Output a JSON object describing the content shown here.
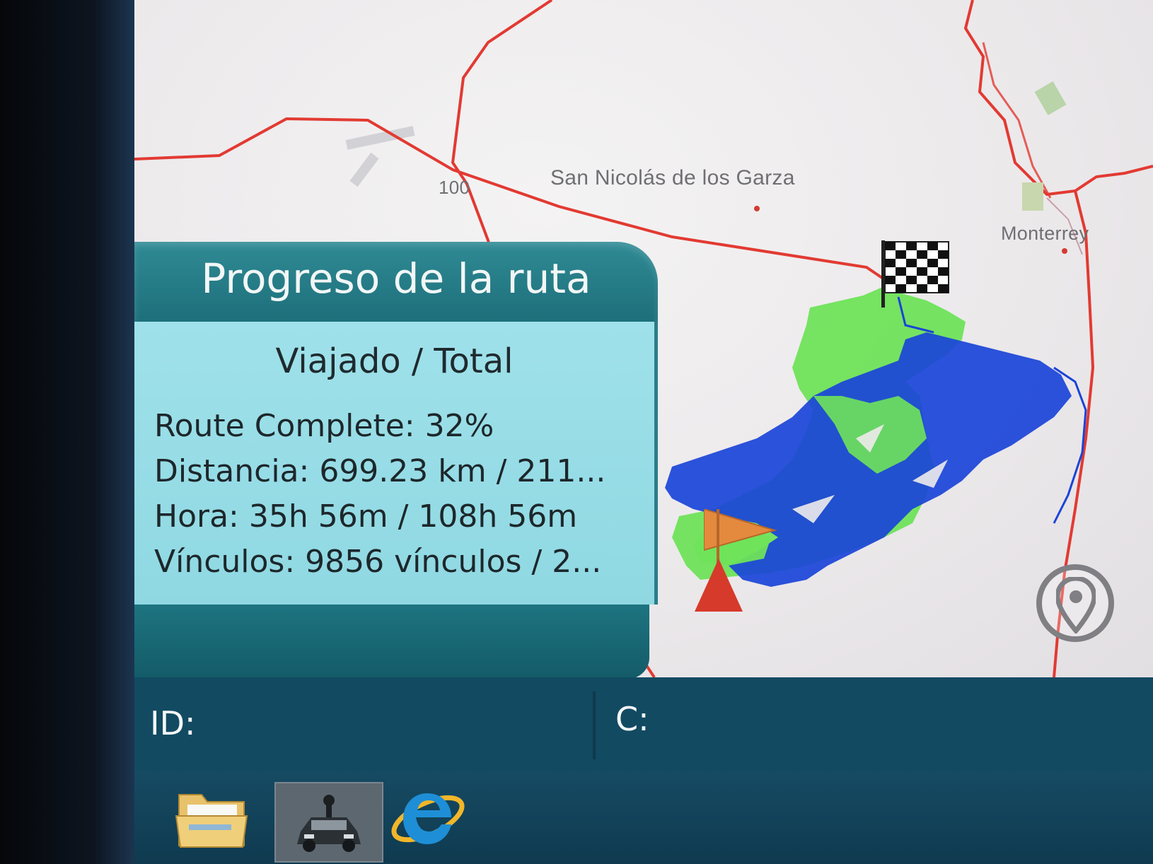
{
  "map": {
    "labels": {
      "road_number": "100",
      "city_1": "San Nicolás de los Garza",
      "city_2": "Monterrey"
    },
    "colors": {
      "road": "#e23a32",
      "route_traveled": "#1a44d8",
      "coverage": "#6fe35a",
      "background": "#eeebec"
    },
    "icons": {
      "destination": "checkered-flag-icon",
      "start": "start-flag-icon",
      "vehicle": "vehicle-cone-icon",
      "locate": "location-pin-icon"
    }
  },
  "route_panel": {
    "title": "Progreso de la ruta",
    "subtitle": "Viajado / Total",
    "route_complete": "Route Complete: 32%",
    "route_complete_percent": 32,
    "distance": "Distancia: 699.23 km / 211...",
    "time": "Hora: 35h 56m / 108h 56m",
    "links": "Vínculos: 9856 vínculos / 2..."
  },
  "status_bar": {
    "id_label": "ID:",
    "c_label": "C:"
  },
  "taskbar": {
    "items": [
      "folder-icon",
      "navigation-app-icon",
      "internet-explorer-icon"
    ],
    "colors": {
      "accent": "#124a62"
    }
  }
}
